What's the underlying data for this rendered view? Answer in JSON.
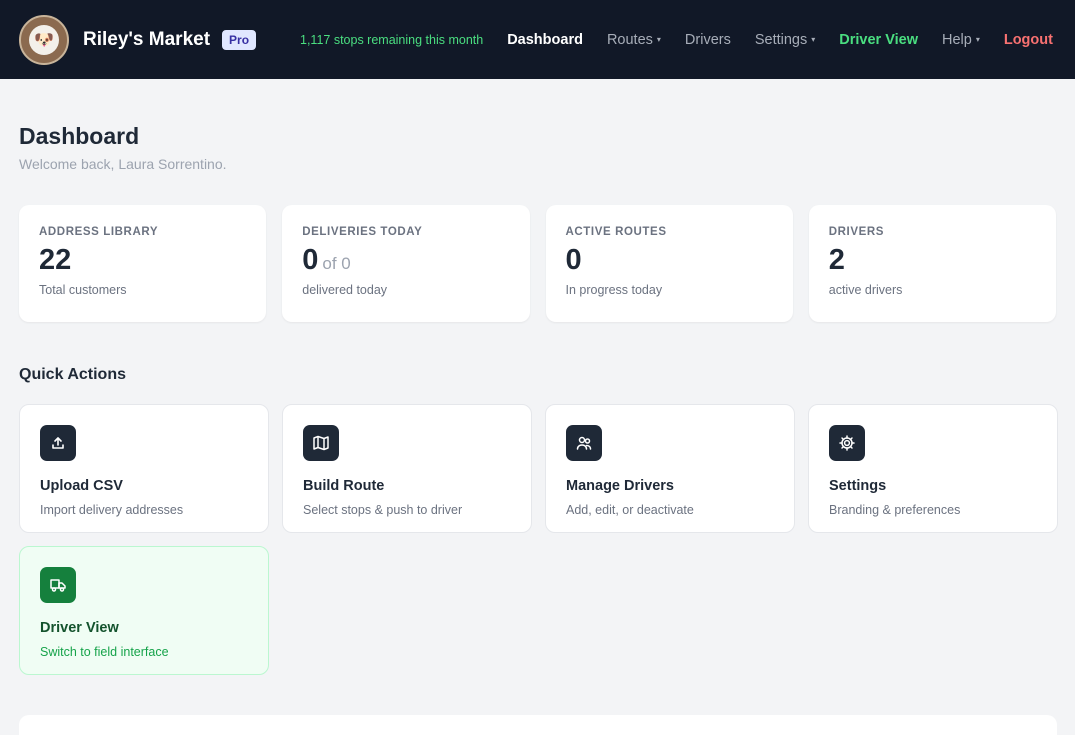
{
  "nav": {
    "brand": "Riley's Market",
    "badge": "Pro",
    "stops_remaining": "1,117 stops remaining this month",
    "links": [
      {
        "label": "Dashboard"
      },
      {
        "label": "Routes"
      },
      {
        "label": "Drivers"
      },
      {
        "label": "Settings"
      },
      {
        "label": "Driver View"
      },
      {
        "label": "Help"
      },
      {
        "label": "Logout"
      }
    ],
    "caret": "▾"
  },
  "page": {
    "title": "Dashboard",
    "subtitle": "Welcome back, Laura Sorrentino."
  },
  "stats": [
    {
      "label": "ADDRESS LIBRARY",
      "value": "22",
      "of": "",
      "note": "Total customers"
    },
    {
      "label": "DELIVERIES TODAY",
      "value": "0",
      "of": "of 0",
      "note": "delivered today"
    },
    {
      "label": "ACTIVE ROUTES",
      "value": "0",
      "of": "",
      "note": "In progress today"
    },
    {
      "label": "DRIVERS",
      "value": "2",
      "of": "",
      "note": "active drivers"
    }
  ],
  "quick_actions": {
    "title": "Quick Actions",
    "items": [
      {
        "icon": "upload-icon",
        "title": "Upload CSV",
        "desc": "Import delivery addresses"
      },
      {
        "icon": "map-icon",
        "title": "Build Route",
        "desc": "Select stops & push to driver"
      },
      {
        "icon": "users-icon",
        "title": "Manage Drivers",
        "desc": "Add, edit, or deactivate"
      },
      {
        "icon": "gear-icon",
        "title": "Settings",
        "desc": "Branding & preferences"
      },
      {
        "icon": "truck-icon",
        "title": "Driver View",
        "desc": "Switch to field interface"
      }
    ]
  },
  "colors": {
    "nav_bg": "#111827",
    "accent_green": "#4ade80",
    "logout_red": "#f87171",
    "pro_badge": "#e0e7ff"
  }
}
